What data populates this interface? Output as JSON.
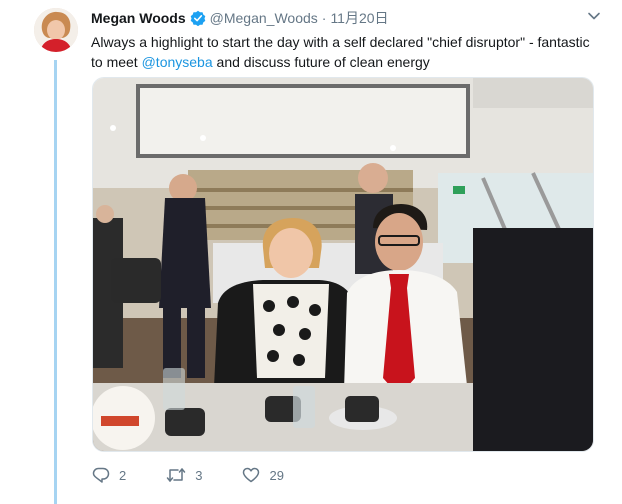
{
  "tweet": {
    "author_name": "Megan Woods",
    "handle": "@Megan_Woods",
    "separator": "·",
    "time": "11月20日",
    "text_part1": "Always a highlight to start the day with a self declared \"chief disruptor\" - fantastic to meet ",
    "mention": "@tonyseba",
    "text_part2": " and discuss future of clean energy"
  },
  "actions": {
    "reply_count": "2",
    "retweet_count": "3",
    "like_count": "29"
  },
  "icons": {
    "verified": "verified-badge-icon",
    "caret": "chevron-down-icon",
    "reply": "reply-icon",
    "retweet": "retweet-icon",
    "like": "heart-icon"
  },
  "colors": {
    "link": "#1b95e0",
    "thread_line": "#a6d4f2",
    "secondary_text": "#657786"
  }
}
